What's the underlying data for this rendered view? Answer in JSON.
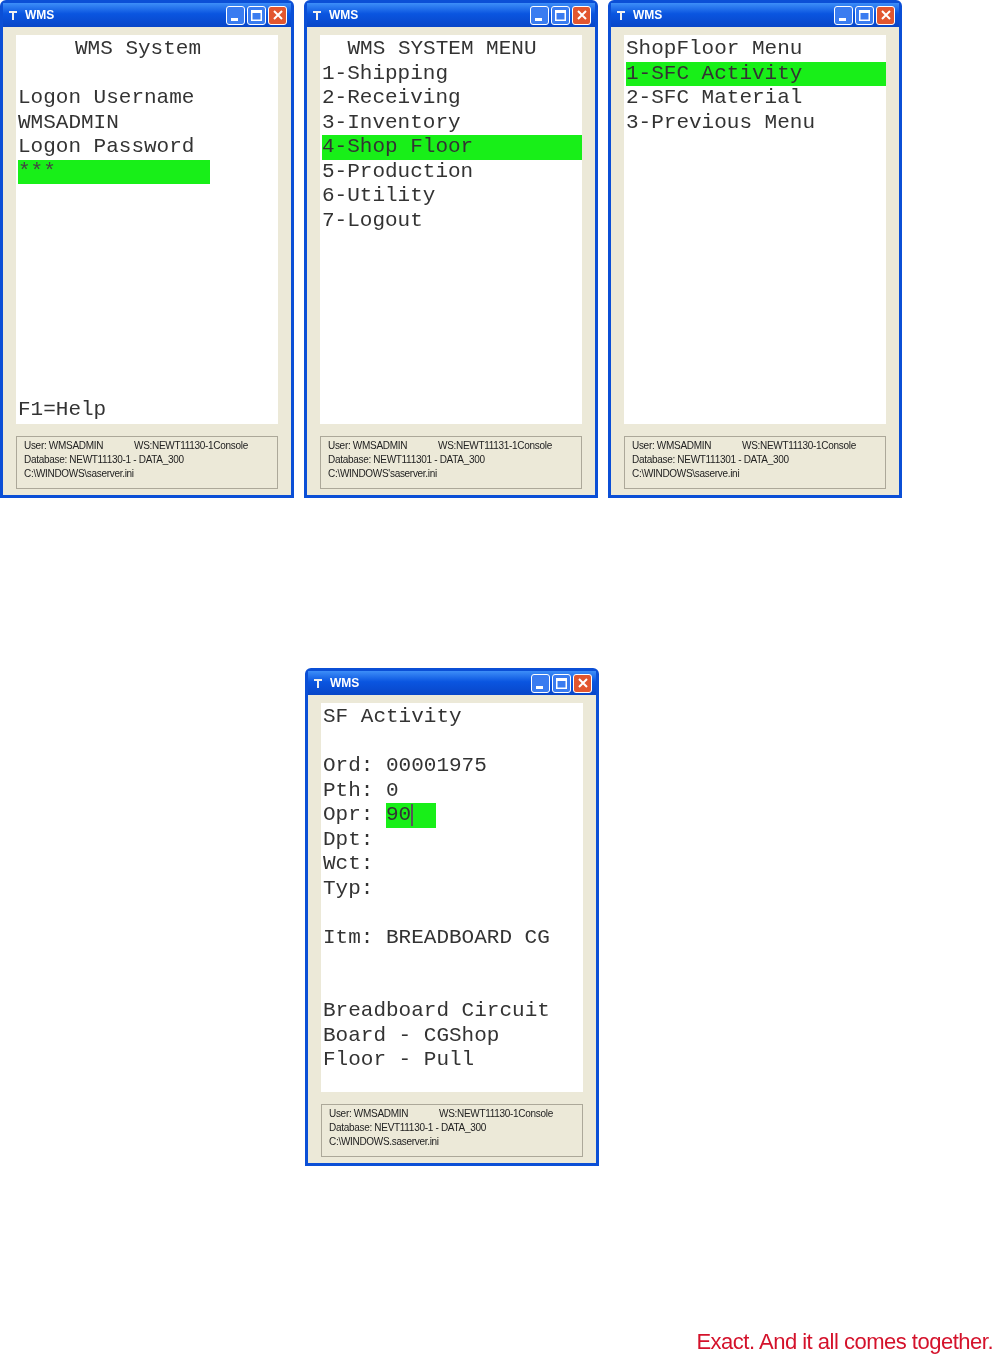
{
  "windows": [
    {
      "title": "WMS",
      "lines": [
        {
          "kind": "heading",
          "text": "WMS System"
        },
        {
          "kind": "gap"
        },
        {
          "kind": "text",
          "text": "Logon Username"
        },
        {
          "kind": "text",
          "text": "WMSADMIN"
        },
        {
          "kind": "text",
          "text": "Logon Password"
        },
        {
          "kind": "field",
          "value": "***",
          "focused": false
        },
        {
          "kind": "footer",
          "text": "F1=Help"
        }
      ],
      "status": {
        "user": "User: WMSADMIN",
        "ws": "WS:NEWT11130-1Console",
        "database": "Database: NEWT11130-1 - DATA_300",
        "path": "C:\\WINDOWS\\saserver.ini"
      }
    },
    {
      "title": "WMS",
      "lines": [
        {
          "kind": "heading",
          "text": "WMS SYSTEM MENU"
        },
        {
          "kind": "menu",
          "text": "1-Shipping",
          "selected": false
        },
        {
          "kind": "menu",
          "text": "2-Receiving",
          "selected": false
        },
        {
          "kind": "menu",
          "text": "3-Inventory",
          "selected": false
        },
        {
          "kind": "menu",
          "text": "4-Shop Floor",
          "selected": true
        },
        {
          "kind": "menu",
          "text": "5-Production",
          "selected": false
        },
        {
          "kind": "menu",
          "text": "6-Utility",
          "selected": false
        },
        {
          "kind": "menu",
          "text": "7-Logout",
          "selected": false
        }
      ],
      "status": {
        "user": "User: WMSADMIN",
        "ws": "WS:NEWT11131-1Console",
        "database": "Database: NEWT111301 - DATA_300",
        "path": "C:\\WINDOWS'saserver.ini"
      }
    },
    {
      "title": "WMS",
      "lines": [
        {
          "kind": "text",
          "text": "ShopFloor Menu"
        },
        {
          "kind": "menu",
          "text": "1-SFC Activity",
          "selected": true
        },
        {
          "kind": "menu",
          "text": "2-SFC Material",
          "selected": false
        },
        {
          "kind": "menu",
          "text": "3-Previous Menu",
          "selected": false
        }
      ],
      "status": {
        "user": "User: WMSADMIN",
        "ws": "WS:NEWT11130-1Console",
        "database": "Database: NEWT111301 - DATA_300",
        "path": "C:\\WINDOWS\\saserve.ini"
      }
    },
    {
      "title": "WMS",
      "lines": [
        {
          "kind": "text",
          "text": "SF Activity"
        },
        {
          "kind": "gap"
        },
        {
          "kind": "pair",
          "label": "Ord:",
          "value": "00001975"
        },
        {
          "kind": "pair",
          "label": "Pth:",
          "value": "0"
        },
        {
          "kind": "input",
          "label": "Opr:",
          "value": "90",
          "focused": true
        },
        {
          "kind": "pair",
          "label": "Dpt:"
        },
        {
          "kind": "pair",
          "label": "Wct:"
        },
        {
          "kind": "pair",
          "label": "Typ:"
        },
        {
          "kind": "gap"
        },
        {
          "kind": "pair",
          "label": "Itm:",
          "value": "BREADBOARD CG"
        },
        {
          "kind": "gap"
        },
        {
          "kind": "gap"
        },
        {
          "kind": "text",
          "text": "Breadboard Circuit"
        },
        {
          "kind": "text",
          "text": "Board - CGShop"
        },
        {
          "kind": "text",
          "text": "Floor - Pull"
        }
      ],
      "status": {
        "user": "User: WMSADMIN",
        "ws": "WS:NEWT11130-1Console",
        "database": "Database: NEVT11130-1 - DATA_300",
        "path": "C:\\WINDOWS.saserver.ini"
      }
    }
  ],
  "tagline": "Exact. And it all comes together."
}
